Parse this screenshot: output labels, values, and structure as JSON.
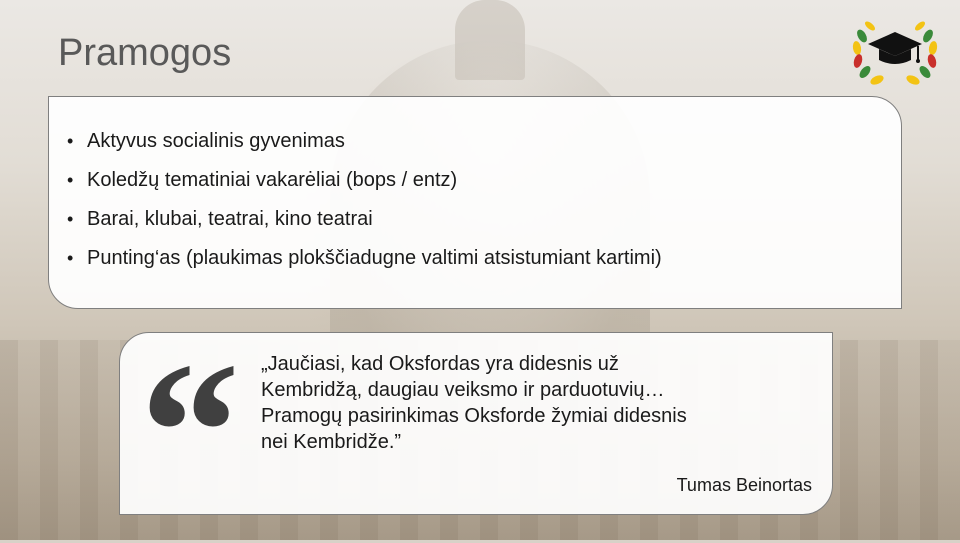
{
  "slide": {
    "title": "Pramogos"
  },
  "bullets": [
    "Aktyvus socialinis gyvenimas",
    "Koledžų tematiniai vakarėliai (bops / entz)",
    "Barai, klubai, teatrai, kino teatrai",
    "Punting‘as (plaukimas plokščiadugne valtimi atsistumiant kartimi)"
  ],
  "quote": {
    "mark": "“",
    "text": "„Jaučiasi, kad Oksfordas yra didesnis už\nKembridžą, daugiau veiksmo ir parduotuvių…\nPramogų pasirinkimas Oksforde žymiai didesnis\nnei Kembridže.”",
    "author": "Tumas Beinortas"
  },
  "logo": {
    "icon": "graduation-cap-laurel-icon",
    "colors": {
      "yellow": "#f3c314",
      "green": "#3a8a3a",
      "red": "#c9302c",
      "cap": "#111111"
    }
  },
  "background": {
    "description_icon": "oxford-dome-photo"
  }
}
